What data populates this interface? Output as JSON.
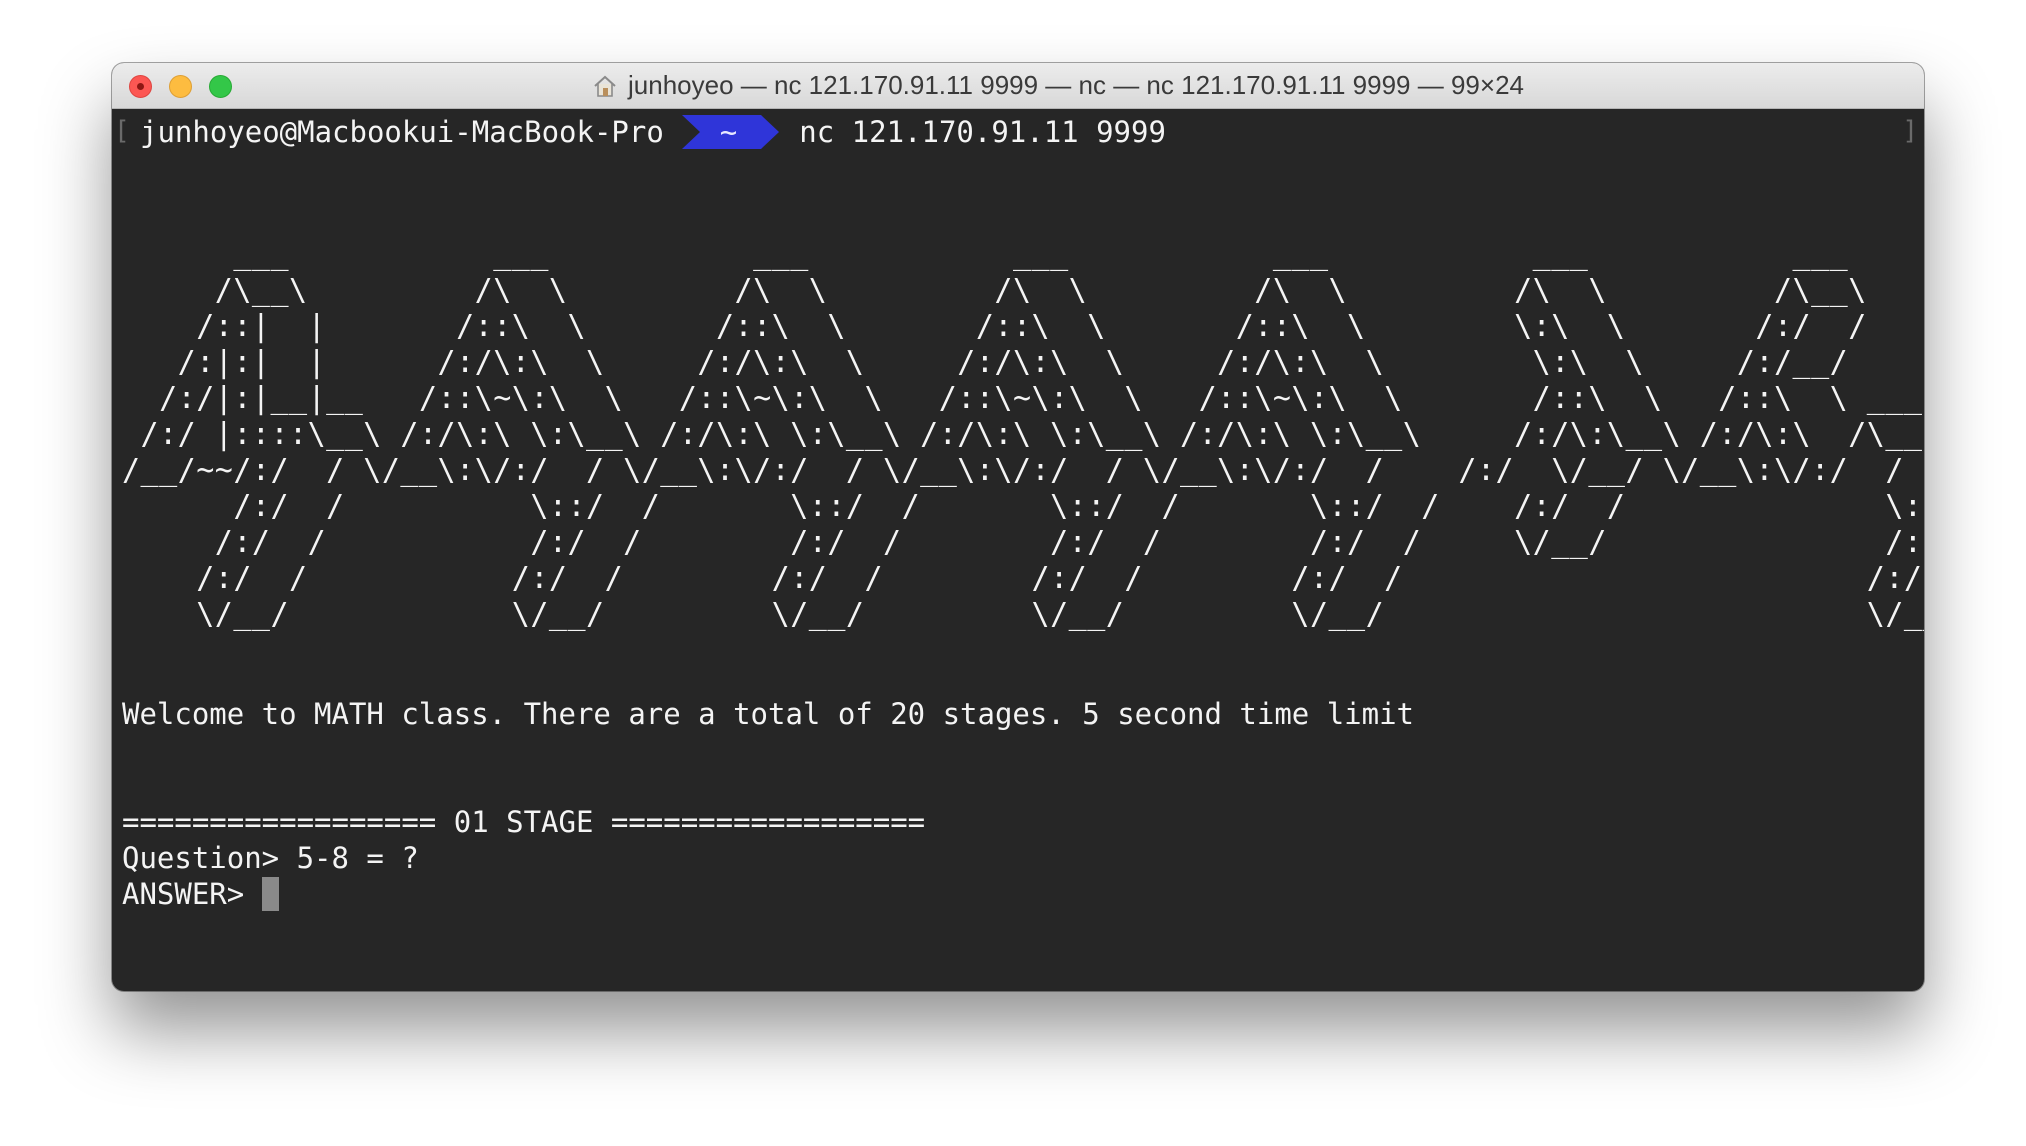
{
  "window": {
    "title": "junhoyeo — nc 121.170.91.11 9999 — nc — nc 121.170.91.11 9999 — 99×24",
    "title_icon": "home-folder-icon"
  },
  "prompt": {
    "user_host": "junhoyeo@Macbookui-MacBook-Pro",
    "directory": "~",
    "command": "nc 121.170.91.11 9999",
    "bracket_left": "[",
    "bracket_right": "]"
  },
  "banner": {
    "ascii_art": "      ___           ___           ___           ___           ___           ___           ___     \n     /\\__\\         /\\  \\         /\\  \\         /\\  \\         /\\  \\         /\\  \\         /\\__\\    \n    /::|  |       /::\\  \\       /::\\  \\       /::\\  \\       /::\\  \\        \\:\\  \\       /:/  /    \n   /:|:|  |      /:/\\:\\  \\     /:/\\:\\  \\     /:/\\:\\  \\     /:/\\:\\  \\        \\:\\  \\     /:/__/     \n  /:/|:|__|__   /::\\~\\:\\  \\   /::\\~\\:\\  \\   /::\\~\\:\\  \\   /::\\~\\:\\  \\       /::\\  \\   /::\\  \\ ___ \n /:/ |::::\\__\\ /:/\\:\\ \\:\\__\\ /:/\\:\\ \\:\\__\\ /:/\\:\\ \\:\\__\\ /:/\\:\\ \\:\\__\\     /:/\\:\\__\\ /:/\\:\\  /\\__\\\n/__/~~/:/  / \\/__\\:\\/:/  / \\/__\\:\\/:/  / \\/__\\:\\/:/  / \\/__\\:\\/:/  /    /:/  \\/__/ \\/__\\:\\/:/  /\n      /:/  /          \\::/  /       \\::/  /       \\::/  /       \\::/  /    /:/  /              \\::/  / \n     /:/  /           /:/  /        /:/  /        /:/  /        /:/  /     \\/__/               /:/  /  \n    /:/  /           /:/  /        /:/  /        /:/  /        /:/  /                         /:/  /   \n    \\/__/            \\/__/         \\/__/         \\/__/         \\/__/                          \\/__/    "
  },
  "output": {
    "welcome": "Welcome to MATH class. There are a total of 20 stages. 5 second time limit",
    "stage_header": "================== 01 STAGE ==================",
    "question": "Question> 5-8 = ?",
    "answer_prompt": "ANSWER>"
  },
  "colors": {
    "terminal_bg": "#262626",
    "text": "#f4f4f4",
    "path_segment": "#2f35d9",
    "close": "#fc5753",
    "minimize": "#fdbc40",
    "zoom": "#33c748"
  }
}
